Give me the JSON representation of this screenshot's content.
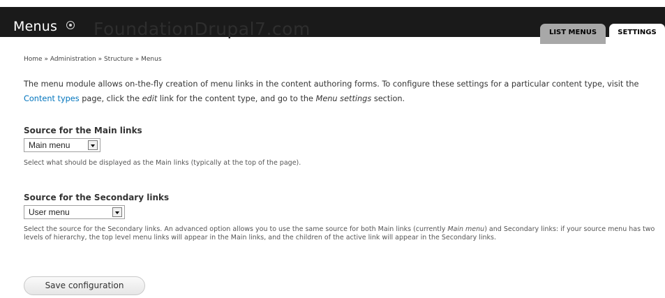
{
  "header": {
    "title": "Menus",
    "watermark": "FoundationDrupal7.com",
    "shortcut_icon": "add-shortcut-icon",
    "tabs": [
      {
        "label": "LIST MENUS",
        "active": false
      },
      {
        "label": "SETTINGS",
        "active": true
      }
    ]
  },
  "breadcrumb": {
    "items": [
      "Home",
      "Administration",
      "Structure",
      "Menus"
    ],
    "separator": "»"
  },
  "intro": {
    "text_1": "The menu module allows on-the-fly creation of menu links in the content authoring forms. To configure these settings for a particular content type, visit the ",
    "link_content_types": "Content types",
    "text_2": " page, click the ",
    "edit_em": "edit",
    "text_3": " link for the content type, and go to the ",
    "menu_settings_em": "Menu settings",
    "text_4": " section."
  },
  "main_links": {
    "label": "Source for the Main links",
    "selected": "Main menu",
    "description": "Select what should be displayed as the Main links (typically at the top of the page)."
  },
  "secondary_links": {
    "label": "Source for the Secondary links",
    "selected": "User menu",
    "description_1": "Select the source for the Secondary links. An advanced option allows you to use the same source for both Main links (currently ",
    "description_em": "Main menu",
    "description_2": ") and Secondary links: if your source menu has two levels of hierarchy, the top level menu links will appear in the Main links, and the children of the active link will appear in the Secondary links."
  },
  "actions": {
    "save_label": "Save configuration"
  },
  "colors": {
    "header_bg": "#1a1a1a",
    "link": "#0074bd",
    "tab_inactive": "#a8a8a8"
  }
}
